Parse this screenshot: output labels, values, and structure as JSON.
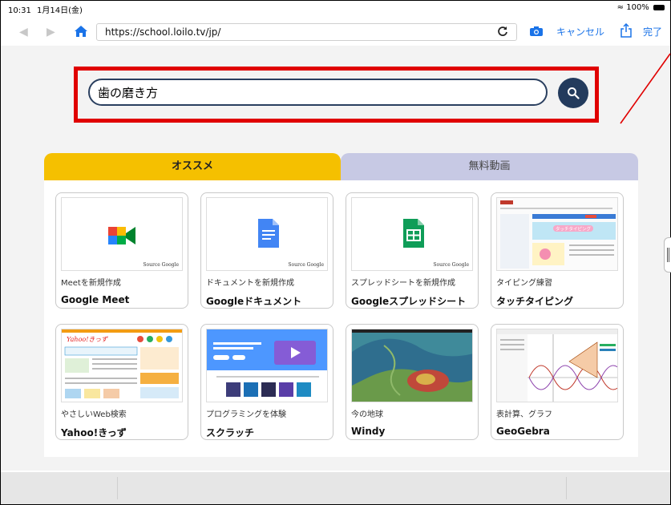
{
  "status_bar": {
    "time": "10:31",
    "date": "1月14日(金)",
    "battery": "100%"
  },
  "browser": {
    "url": "https://school.loilo.tv/jp/",
    "cancel_label": "キャンセル",
    "done_label": "完了"
  },
  "search": {
    "query": "歯の磨き方"
  },
  "tabs": {
    "recommended": "オススメ",
    "free_video": "無料動画"
  },
  "cards": [
    {
      "caption": "Meetを新規作成",
      "name": "Google Meet",
      "source": "Source Google"
    },
    {
      "caption": "ドキュメントを新規作成",
      "name": "Googleドキュメント",
      "source": "Source Google"
    },
    {
      "caption": "スプレッドシートを新規作成",
      "name": "Googleスプレッドシート",
      "source": "Source Google"
    },
    {
      "caption": "タイピング練習",
      "name": "タッチタイピング",
      "thumb_text": "タッチタイピング"
    },
    {
      "caption": "やさしいWeb検索",
      "name": "Yahoo!きっず",
      "thumb_text": "Yahoo!きっず"
    },
    {
      "caption": "プログラミングを体験",
      "name": "スクラッチ"
    },
    {
      "caption": "今の地球",
      "name": "Windy"
    },
    {
      "caption": "表計算、グラフ",
      "name": "GeoGebra"
    }
  ],
  "colors": {
    "accent_blue": "#1a73e8",
    "tab_active": "#f5c000",
    "tab_inactive": "#c7c9e4",
    "highlight_red": "#e00000",
    "search_button": "#233b5d"
  }
}
